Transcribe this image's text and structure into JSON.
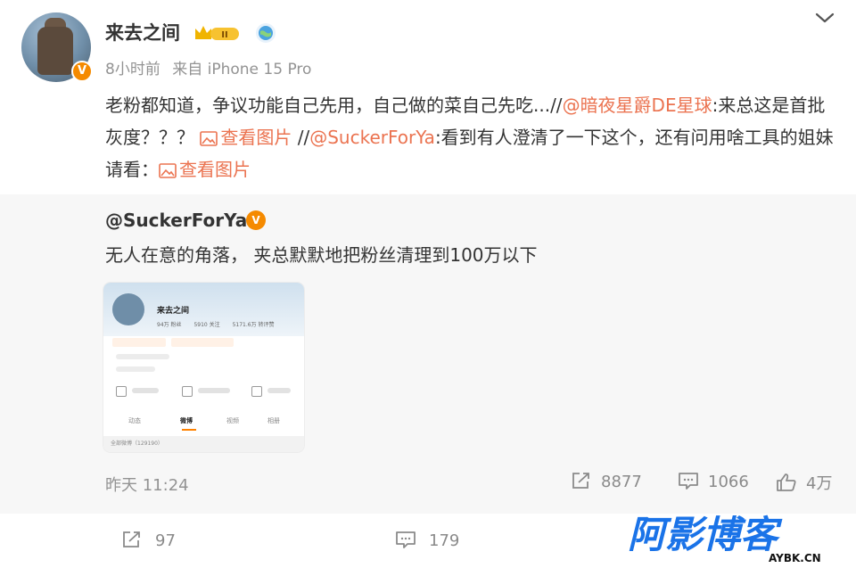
{
  "post": {
    "author": "来去之间",
    "avatar_badge": "V",
    "time": "8小时前",
    "source": "来自 iPhone 15 Pro",
    "level_badge_text": "II",
    "content": {
      "part1": "老粉都知道，争议功能自己先用，自己做的菜自己先吃...//",
      "mention1": "@暗夜星爵DE星球",
      "part2": ":来总这是首批灰度？？？ ",
      "pic_link1": "查看图片",
      "part3": " //",
      "mention2": "@SuckerForYa",
      "part4": ":看到有人澄清了一下这个，还有问用啥工具的姐妹请看：",
      "pic_link2": "查看图片"
    }
  },
  "repost": {
    "user": "@SuckerForYa",
    "user_badge": "V",
    "text": "无人在意的角落， 夹总默默地把粉丝清理到100万以下",
    "time": "昨天 11:24",
    "reposts": "8877",
    "comments": "1066",
    "likes": "4万",
    "thumbnail": {
      "name": "来去之间",
      "stats": [
        "94万 粉丝",
        "5910 关注",
        "5171.6万 转评赞"
      ],
      "tabs": [
        "动态",
        "微博",
        "视频",
        "相册"
      ],
      "footer": "全部微博（129190）"
    }
  },
  "footer": {
    "reposts": "97",
    "comments": "179"
  },
  "watermark": {
    "brand": "阿影博客",
    "domain": "AYBK.CN"
  },
  "colors": {
    "accent": "#eb7350",
    "badge_orange": "#f58a00",
    "muted": "#939393",
    "repost_bg": "#f7f7f7",
    "watermark_blue": "#1a73e8"
  }
}
